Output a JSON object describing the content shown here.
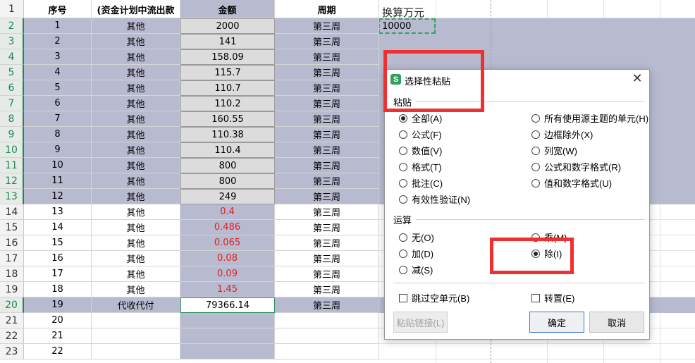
{
  "headers": {
    "row_number": "1",
    "col_seq": "序号",
    "col_type": "(资金计划中流出款",
    "col_amount": "金额",
    "col_week": "周期"
  },
  "rows": [
    {
      "rownum": "2",
      "seq": "1",
      "type": "其他",
      "amount": "2000",
      "week": "第三周"
    },
    {
      "rownum": "3",
      "seq": "2",
      "type": "其他",
      "amount": "141",
      "week": "第三周"
    },
    {
      "rownum": "4",
      "seq": "3",
      "type": "其他",
      "amount": "158.09",
      "week": "第三周"
    },
    {
      "rownum": "5",
      "seq": "4",
      "type": "其他",
      "amount": "115.7",
      "week": "第三周"
    },
    {
      "rownum": "6",
      "seq": "5",
      "type": "其他",
      "amount": "110.7",
      "week": "第三周"
    },
    {
      "rownum": "7",
      "seq": "6",
      "type": "其他",
      "amount": "110.2",
      "week": "第三周"
    },
    {
      "rownum": "8",
      "seq": "7",
      "type": "其他",
      "amount": "160.55",
      "week": "第三周"
    },
    {
      "rownum": "9",
      "seq": "8",
      "type": "其他",
      "amount": "110.38",
      "week": "第三周"
    },
    {
      "rownum": "10",
      "seq": "9",
      "type": "其他",
      "amount": "110.4",
      "week": "第三周"
    },
    {
      "rownum": "11",
      "seq": "10",
      "type": "其他",
      "amount": "800",
      "week": "第三周"
    },
    {
      "rownum": "12",
      "seq": "11",
      "type": "其他",
      "amount": "800",
      "week": "第三周"
    },
    {
      "rownum": "13",
      "seq": "12",
      "type": "其他",
      "amount": "249",
      "week": "第三周"
    },
    {
      "rownum": "14",
      "seq": "13",
      "type": "其他",
      "amount": "0.4",
      "week": "第三周"
    },
    {
      "rownum": "15",
      "seq": "14",
      "type": "其他",
      "amount": "0.486",
      "week": "第三周"
    },
    {
      "rownum": "16",
      "seq": "15",
      "type": "其他",
      "amount": "0.065",
      "week": "第三周"
    },
    {
      "rownum": "17",
      "seq": "16",
      "type": "其他",
      "amount": "0.08",
      "week": "第三周"
    },
    {
      "rownum": "18",
      "seq": "17",
      "type": "其他",
      "amount": "0.09",
      "week": "第三周"
    },
    {
      "rownum": "19",
      "seq": "18",
      "type": "其他",
      "amount": "1.45",
      "week": "第三周"
    },
    {
      "rownum": "20",
      "seq": "19",
      "type": "代收代付",
      "amount": "79366.14",
      "week": "第三周"
    },
    {
      "rownum": "21",
      "seq": "20",
      "type": "",
      "amount": "",
      "week": ""
    },
    {
      "rownum": "22",
      "seq": "21",
      "type": "",
      "amount": "",
      "week": ""
    },
    {
      "rownum": "23",
      "seq": "22",
      "type": "",
      "amount": "",
      "week": ""
    }
  ],
  "side": {
    "label": "换算万元",
    "copied_value": "10000"
  },
  "dialog": {
    "title": "选择性粘贴",
    "paste_group": "粘贴",
    "paste_left": [
      "全部(A)",
      "公式(F)",
      "数值(V)",
      "格式(T)",
      "批注(C)",
      "有效性验证(N)"
    ],
    "paste_right": [
      "所有使用源主题的单元(H)",
      "边框除外(X)",
      "列宽(W)",
      "公式和数字格式(R)",
      "值和数字格式(U)"
    ],
    "operation_group": "运算",
    "op_left": [
      "无(O)",
      "加(D)",
      "减(S)"
    ],
    "op_right": [
      "乘(M)",
      "除(I)"
    ],
    "skip_blanks": "跳过空单元(B)",
    "transpose": "转置(E)",
    "paste_link": "粘贴链接(L)",
    "ok": "确定",
    "cancel": "取消",
    "close": "✕",
    "icon_letter": "S"
  },
  "colors": {
    "band": "#b8bad0",
    "selection_green": "#1e8a50",
    "highlight_red": "#ef3030",
    "negative_red": "#e02020"
  }
}
